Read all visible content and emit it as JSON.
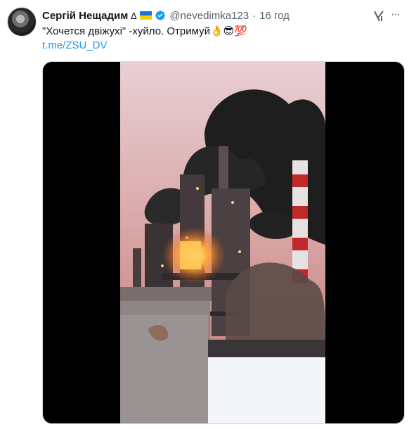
{
  "tweet": {
    "author_name": "Сергій Нещадим",
    "author_symbol": "∆",
    "handle": "@nevedimka123",
    "separator": "·",
    "time": "16 год",
    "text": "\"Хочется двіжухі\" -хуйло. Отримуй👌😎💯",
    "link": "t.me/ZSU_DV",
    "more_label": "···"
  },
  "colors": {
    "link": "#1d9bf0",
    "verified": "#1d9bf0",
    "secondary_text": "#536471",
    "media_background": "#000000"
  },
  "icons": [
    "avatar",
    "ukraine-flag-icon",
    "verified-badge-icon",
    "grok-icon",
    "more-icon",
    "video-frame"
  ]
}
